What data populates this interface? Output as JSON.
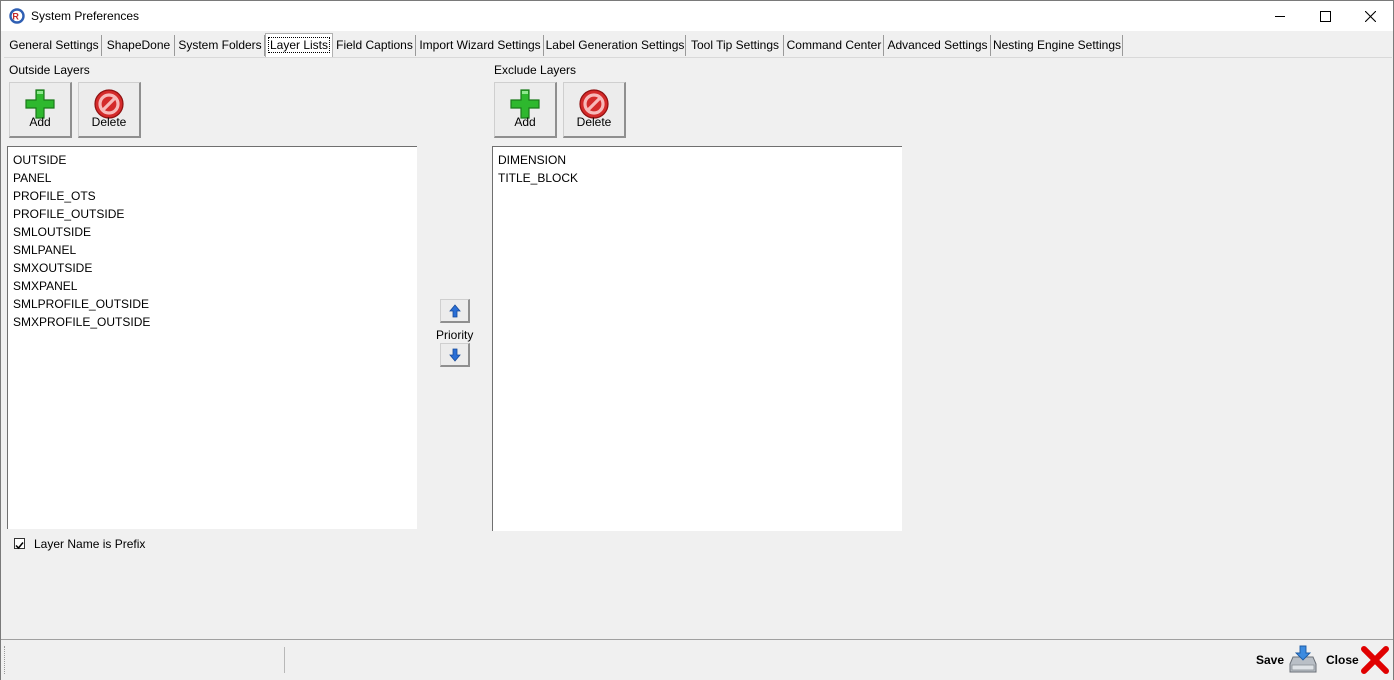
{
  "window": {
    "title": "System Preferences"
  },
  "tabs": [
    {
      "label": "General Settings"
    },
    {
      "label": "ShapeDone"
    },
    {
      "label": "System Folders"
    },
    {
      "label": "Layer Lists"
    },
    {
      "label": "Field Captions"
    },
    {
      "label": "Import Wizard Settings"
    },
    {
      "label": "Label Generation Settings"
    },
    {
      "label": "Tool Tip Settings"
    },
    {
      "label": "Command Center"
    },
    {
      "label": "Advanced Settings"
    },
    {
      "label": "Nesting Engine Settings"
    }
  ],
  "active_tab": "Layer Lists",
  "outside": {
    "label": "Outside Layers",
    "add_label": "Add",
    "delete_label": "Delete",
    "items": [
      "OUTSIDE",
      "PANEL",
      "PROFILE_OTS",
      "PROFILE_OUTSIDE",
      "SMLOUTSIDE",
      "SMLPANEL",
      "SMXOUTSIDE",
      "SMXPANEL",
      "SMLPROFILE_OUTSIDE",
      "SMXPROFILE_OUTSIDE"
    ]
  },
  "priority": {
    "label": "Priority"
  },
  "exclude": {
    "label": "Exclude Layers",
    "add_label": "Add",
    "delete_label": "Delete",
    "items": [
      "DIMENSION",
      "TITLE_BLOCK"
    ]
  },
  "prefix_option": {
    "label": "Layer Name is Prefix",
    "checked": true
  },
  "footer": {
    "save_label": "Save",
    "close_label": "Close"
  },
  "icons": {
    "add": "plus-icon",
    "delete": "prohibited-icon",
    "up": "arrow-up-icon",
    "down": "arrow-down-icon",
    "save": "save-icon",
    "close": "close-x-icon"
  },
  "colors": {
    "add_green": "#2eb82e",
    "delete_red": "#d42a2a",
    "close_red": "#e00000",
    "arrow_blue": "#2a6fd6"
  }
}
